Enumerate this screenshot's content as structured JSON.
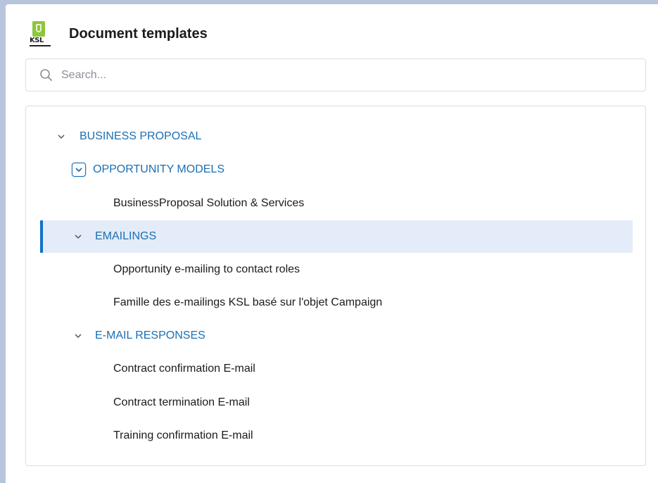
{
  "header": {
    "title": "Document templates",
    "logo_text": "KSL"
  },
  "search": {
    "placeholder": "Search..."
  },
  "tree": {
    "business_proposal": "BUSINESS PROPOSAL",
    "opportunity_models": "OPPORTUNITY MODELS",
    "bp_solution": "BusinessProposal Solution & Services",
    "emailings": "EMAILINGS",
    "opp_emailing": "Opportunity e-mailing to contact roles",
    "famille": "Famille des e-mailings KSL basé sur l'objet Campaign",
    "email_responses": "E-MAIL RESPONSES",
    "contract_confirmation": "Contract confirmation E-mail",
    "contract_termination": "Contract termination E-mail",
    "training_confirmation": "Training confirmation E-mail"
  },
  "colors": {
    "accent": "#1a6fb4",
    "selected_bg": "#e3ecf8",
    "selected_bar": "#1470c8",
    "background": "#b7c5dc"
  }
}
